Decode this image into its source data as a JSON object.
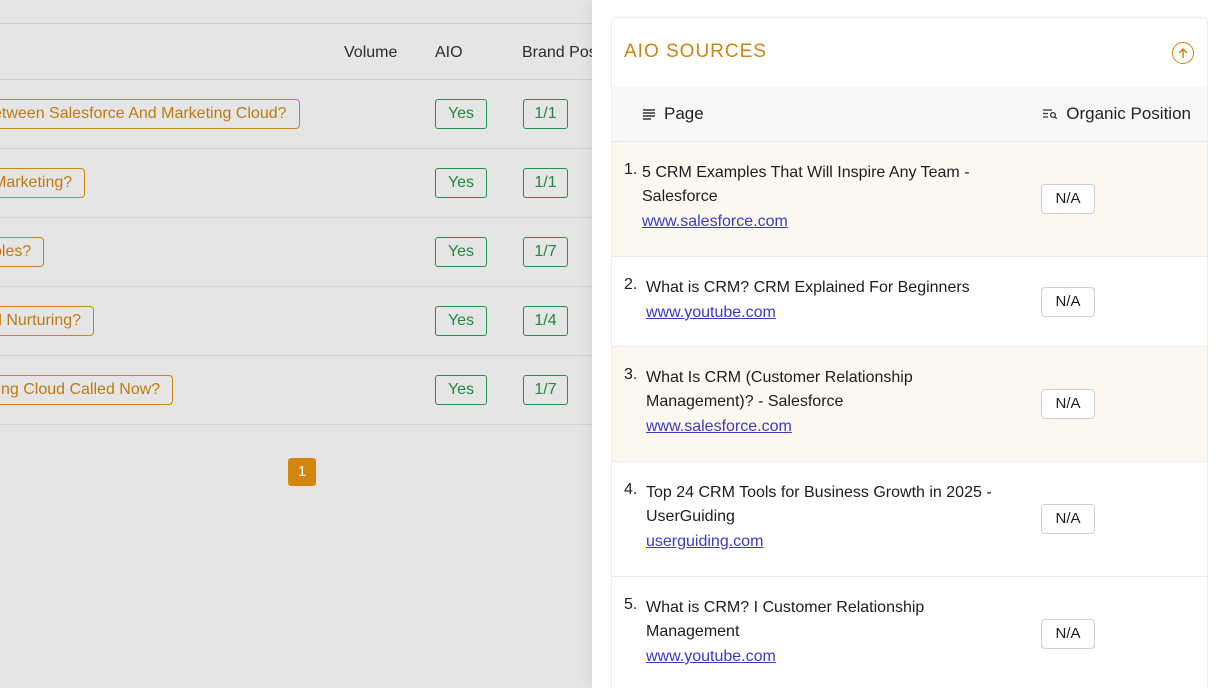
{
  "background_table": {
    "columns": {
      "volume": "Volume",
      "aio": "AIO",
      "brand_position": "Brand Pos"
    },
    "rows": [
      {
        "keyword": "etween Salesforce And Marketing Cloud?",
        "aio": "Yes",
        "brand_position": "1/1"
      },
      {
        "keyword": " Marketing?",
        "aio": "Yes",
        "brand_position": "1/1"
      },
      {
        "keyword": "ples?",
        "aio": "Yes",
        "brand_position": "1/7"
      },
      {
        "keyword": "d Nurturing?",
        "aio": "Yes",
        "brand_position": "1/4"
      },
      {
        "keyword": "ting Cloud Called Now?",
        "aio": "Yes",
        "brand_position": "1/7"
      }
    ],
    "pagination": {
      "current_page": "1"
    }
  },
  "drawer": {
    "title": "AIO SOURCES",
    "collapse_icon": "arrow-up-circle-icon",
    "list_header": {
      "page_label": "Page",
      "page_icon": "lines-icon",
      "organic_label": "Organic Position",
      "organic_icon": "list-search-icon"
    },
    "sources": [
      {
        "num": "1.",
        "title": "5 CRM Examples That Will Inspire Any Team - Salesforce",
        "domain": "www.salesforce.com",
        "organic_position": "N/A"
      },
      {
        "num": "2.",
        "title": "What is CRM? CRM Explained For Beginners",
        "domain": "www.youtube.com",
        "organic_position": "N/A"
      },
      {
        "num": "3.",
        "title": "What Is CRM (Customer Relationship Management)? - Salesforce",
        "domain": "www.salesforce.com",
        "organic_position": "N/A"
      },
      {
        "num": "4.",
        "title": "Top 24 CRM Tools for Business Growth in 2025 - UserGuiding",
        "domain": "userguiding.com",
        "organic_position": "N/A"
      },
      {
        "num": "5.",
        "title": "What is CRM? I Customer Relationship Management",
        "domain": "www.youtube.com",
        "organic_position": "N/A"
      }
    ]
  },
  "colors": {
    "accent": "#c98414",
    "success": "#21883f",
    "link": "#3a3ac9",
    "row_highlight": "#fdf8ef"
  }
}
